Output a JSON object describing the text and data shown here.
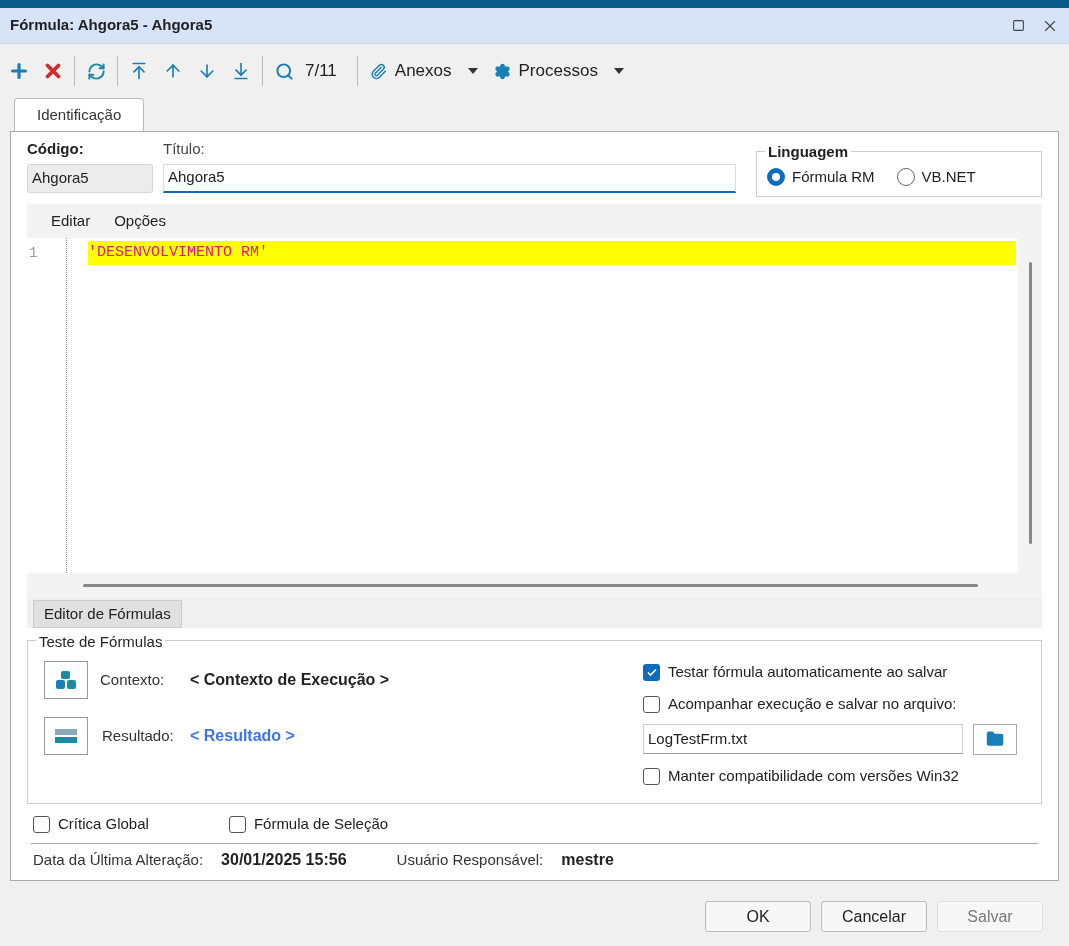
{
  "window": {
    "title": "Fórmula: Ahgora5 - Ahgora5"
  },
  "toolbar": {
    "record_position": "7/11",
    "menus": [
      {
        "label": "Anexos",
        "kind": "attach"
      },
      {
        "label": "Processos",
        "kind": "gear"
      }
    ]
  },
  "tabs": [
    {
      "label": "Identificação",
      "selected": true
    }
  ],
  "fields": {
    "codigo": {
      "label": "Código:",
      "value": "Ahgora5"
    },
    "titulo": {
      "label": "Título:",
      "value": "Ahgora5"
    }
  },
  "linguagem": {
    "title": "Linguagem",
    "options": [
      {
        "label": "Fórmula RM",
        "selected": true
      },
      {
        "label": "VB.NET",
        "selected": false
      }
    ]
  },
  "editor": {
    "menu": [
      "Editar",
      "Opções"
    ],
    "lines": [
      {
        "number": "1",
        "text": "'DESENVOLVIMENTO RM'",
        "highlighted": true
      }
    ]
  },
  "bottom_tabs": [
    {
      "label": "Editor de Fórmulas",
      "selected": true
    }
  ],
  "test": {
    "title": "Teste de Fórmulas",
    "contexto": {
      "label": "Contexto:",
      "value": "< Contexto de Execução >"
    },
    "resultado": {
      "label": "Resultado:",
      "value": "< Resultado >"
    },
    "options": [
      {
        "label": "Testar fórmula automaticamente ao salvar",
        "checked": true
      },
      {
        "label": "Acompanhar execução e salvar no arquivo:",
        "checked": false
      }
    ],
    "log_file": "LogTestFrm.txt",
    "compat": {
      "label": "Manter compatibilidade com versões Win32",
      "checked": false
    }
  },
  "flags": [
    {
      "label": "Crítica Global",
      "checked": false
    },
    {
      "label": "Fórmula de Seleção",
      "checked": false
    }
  ],
  "info": [
    {
      "label": "Data da Última Alteração:",
      "value": "30/01/2025 15:56"
    },
    {
      "label": "Usuário Responsável:",
      "value": "mestre"
    }
  ],
  "buttons": [
    {
      "label": "OK",
      "disabled": false
    },
    {
      "label": "Cancelar",
      "disabled": false
    },
    {
      "label": "Salvar",
      "disabled": true
    }
  ]
}
